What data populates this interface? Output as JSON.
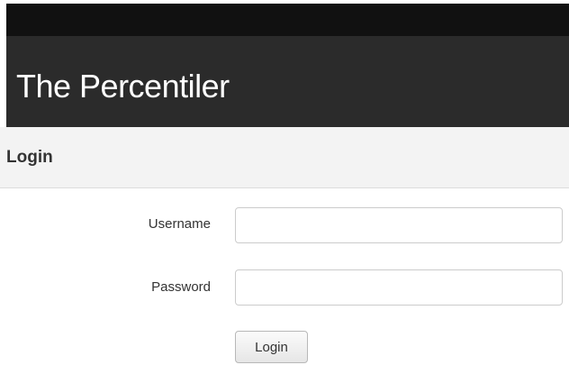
{
  "header": {
    "site_title": "The Percentiler"
  },
  "login_section": {
    "title": "Login"
  },
  "form": {
    "username_label": "Username",
    "username_value": "",
    "password_label": "Password",
    "password_value": "",
    "submit_label": "Login"
  },
  "colors": {
    "top_bar": "#111111",
    "banner": "#2b2b2b",
    "section_header_bg": "#f3f3f3",
    "text": "#333333"
  }
}
